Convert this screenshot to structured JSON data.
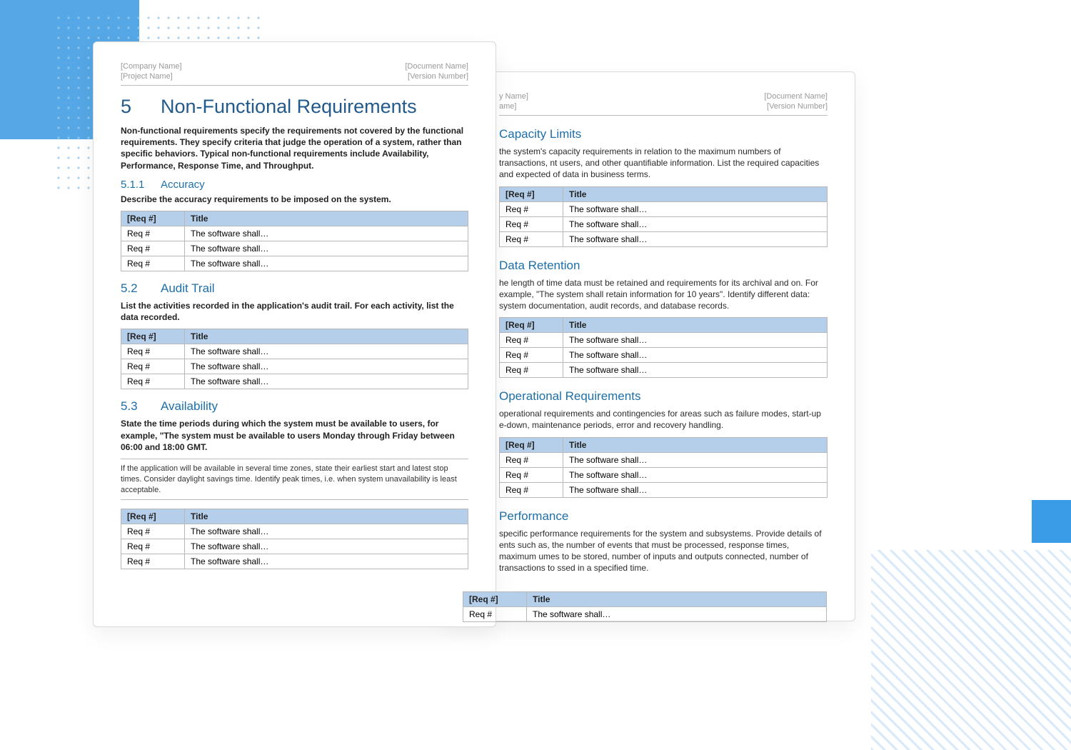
{
  "meta": {
    "company": "[Company Name]",
    "project": "[Project Name]",
    "document": "[Document Name]",
    "version": "[Version Number]",
    "company_r": "y Name]",
    "project_r": "ame]"
  },
  "h1": {
    "num": "5",
    "title": "Non-Functional Requirements"
  },
  "intro": "Non-functional requirements specify the requirements not covered by the functional requirements. They specify criteria that judge the operation of a system, rather than specific behaviors. Typical non-functional requirements include Availability, Performance, Response Time, and Throughput.",
  "table_headers": {
    "req": "[Req #]",
    "title": "Title",
    "req_plain": "Req #"
  },
  "generic_rows": [
    {
      "req": "Req #",
      "title": "The software shall…"
    },
    {
      "req": "Req #",
      "title": "The software shall…"
    },
    {
      "req": "Req #",
      "title": "The software shall…"
    }
  ],
  "single_row": [
    {
      "req": "Req #",
      "title": "The software shall…"
    }
  ],
  "s511": {
    "num": "5.1.1",
    "title": "Accuracy",
    "body": "Describe the accuracy requirements to be imposed on the system."
  },
  "s52": {
    "num": "5.2",
    "title": "Audit Trail",
    "body": "List the activities recorded in the application's audit trail. For each activity, list the data recorded."
  },
  "s53": {
    "num": "5.3",
    "title": "Availability",
    "body": "State the time periods during which the system must be available to users, for example, \"The system must be available to users Monday through Friday between 06:00 and 18:00 GMT.",
    "note": "If the application will be available in several time zones, state their earliest start and latest stop times. Consider daylight savings time. Identify peak times, i.e. when system unavailability is least acceptable."
  },
  "r_cap": {
    "title": "Capacity Limits",
    "body": "the system's capacity requirements in relation to the maximum numbers of transactions, nt users, and other quantifiable information. List the required capacities and expected of data in business terms."
  },
  "r_ret": {
    "title": "Data Retention",
    "body": "he length of time data must be retained and requirements for its archival and on. For example, \"The system shall retain information for 10 years\". Identify different data: system documentation, audit records, and database records."
  },
  "r_op": {
    "title": "Operational Requirements",
    "body": "operational requirements and contingencies for areas such as failure modes, start-up e-down, maintenance periods, error and recovery handling."
  },
  "r_perf": {
    "title": "Performance",
    "body": "specific performance requirements for the system and subsystems. Provide details of ents such as, the number of events that must be processed, response times, maximum umes to be stored, number of inputs and outputs connected, number of transactions to ssed in a specified time."
  }
}
